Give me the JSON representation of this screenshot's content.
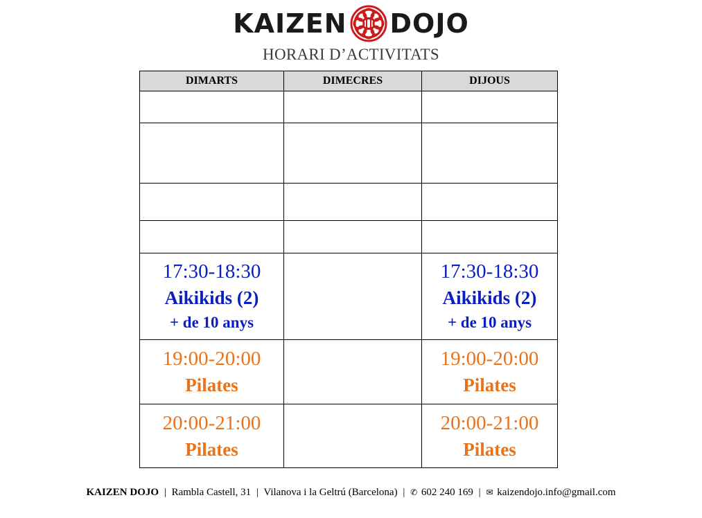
{
  "logo": {
    "left_word": "KAIZEN",
    "right_word": "DOJO",
    "emblem_icon": "dojo-knot-emblem-icon"
  },
  "title": "HORARI D’ACTIVITATS",
  "table": {
    "headers": [
      "DIMARTS",
      "DIMECRES",
      "DIJOUS"
    ],
    "rows": [
      {
        "cells": [
          {},
          {},
          {}
        ]
      },
      {
        "cells": [
          {},
          {},
          {}
        ]
      },
      {
        "cells": [
          {},
          {},
          {}
        ]
      },
      {
        "cells": [
          {},
          {},
          {}
        ]
      },
      {
        "cells": [
          {
            "time": "17:30-18:30",
            "name": "Aikikids (2)",
            "age": "+ de 10 anys"
          },
          {},
          {
            "time": "17:30-18:30",
            "name": "Aikikids (2)",
            "age": "+ de 10 anys"
          }
        ]
      },
      {
        "cells": [
          {
            "time": "19:00-20:00",
            "name": "Pilates"
          },
          {},
          {
            "time": "19:00-20:00",
            "name": "Pilates"
          }
        ]
      },
      {
        "cells": [
          {
            "time": "20:00-21:00",
            "name": "Pilates"
          },
          {},
          {
            "time": "20:00-21:00",
            "name": "Pilates"
          }
        ]
      }
    ]
  },
  "colors": {
    "aikikids": "#0a1fbf",
    "pilates": "#e8731a",
    "logo_red": "#cc1a1a",
    "header_bg": "#d9d9d9"
  },
  "footer": {
    "name": "KAIZEN DOJO",
    "address": "Rambla Castell, 31",
    "city": "Vilanova i la Geltrú (Barcelona)",
    "phone_icon": "phone-icon",
    "phone": "602 240 169",
    "email_icon": "envelope-icon",
    "email": "kaizendojo.info@gmail.com",
    "separator": "|"
  }
}
